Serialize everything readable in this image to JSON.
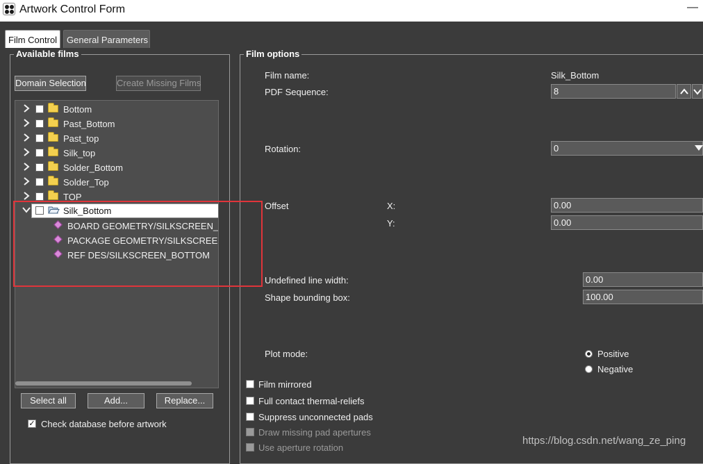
{
  "window": {
    "title": "Artwork Control Form",
    "minimize_glyph": "—"
  },
  "tabs": [
    {
      "label": "Film Control",
      "active": true
    },
    {
      "label": "General Parameters",
      "active": false
    }
  ],
  "available_films": {
    "title": "Available films",
    "domain_selection_label": "Domain Selection",
    "create_missing_label": "Create Missing Films",
    "tree": [
      {
        "label": "Bottom",
        "expanded": false,
        "checked": false
      },
      {
        "label": "Past_Bottom",
        "expanded": false,
        "checked": false
      },
      {
        "label": "Past_top",
        "expanded": false,
        "checked": false
      },
      {
        "label": "Silk_top",
        "expanded": false,
        "checked": false
      },
      {
        "label": "Solder_Bottom",
        "expanded": false,
        "checked": false
      },
      {
        "label": "Solder_Top",
        "expanded": false,
        "checked": false
      },
      {
        "label": "TOP",
        "expanded": false,
        "checked": false
      },
      {
        "label": "Silk_Bottom",
        "expanded": true,
        "checked": false,
        "selected": true,
        "layers": [
          "BOARD GEOMETRY/SILKSCREEN_BOT",
          "PACKAGE GEOMETRY/SILKSCREEN_BO",
          "REF DES/SILKSCREEN_BOTTOM"
        ]
      }
    ],
    "select_all_label": "Select all",
    "add_label": "Add...",
    "replace_label": "Replace...",
    "check_database_label": "Check database before artwork",
    "check_database_checked": true
  },
  "film_options": {
    "title": "Film options",
    "film_name_label": "Film name:",
    "film_name_value": "Silk_Bottom",
    "pdf_sequence_label": "PDF Sequence:",
    "pdf_sequence_value": "8",
    "rotation_label": "Rotation:",
    "rotation_value": "0",
    "offset_label": "Offset",
    "offset_x_label": "X:",
    "offset_x_value": "0.00",
    "offset_y_label": "Y:",
    "offset_y_value": "0.00",
    "undefined_line_width_label": "Undefined line width:",
    "undefined_line_width_value": "0.00",
    "shape_bounding_box_label": "Shape bounding box:",
    "shape_bounding_box_value": "100.00",
    "plot_mode_label": "Plot mode:",
    "plot_mode_options": [
      "Positive",
      "Negative"
    ],
    "plot_mode_selected": "Positive",
    "checkboxes": [
      {
        "label": "Film mirrored",
        "checked": false,
        "enabled": true
      },
      {
        "label": "Full contact thermal-reliefs",
        "checked": false,
        "enabled": true
      },
      {
        "label": "Suppress unconnected pads",
        "checked": false,
        "enabled": true
      },
      {
        "label": "Draw missing pad apertures",
        "checked": false,
        "enabled": false
      },
      {
        "label": "Use aperture rotation",
        "checked": false,
        "enabled": false
      }
    ]
  },
  "watermark": "https://blog.csdn.net/wang_ze_ping",
  "colors": {
    "background": "#3b3b3b",
    "highlight_box": "#e0343a",
    "folder": "#f3d04f",
    "layer_icon": "#d98ad9"
  }
}
